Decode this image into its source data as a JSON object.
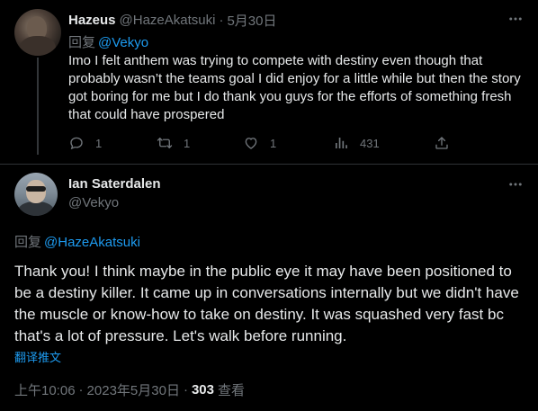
{
  "reply_tweet": {
    "author_name": "Hazeus",
    "author_handle": "@HazeAkatsuki",
    "separator": "·",
    "date": "5月30日",
    "reply_prefix": "回复",
    "reply_to": "@Vekyo",
    "text": "Imo I felt anthem was trying to compete with destiny even though that probably wasn’t the teams goal I did enjoy for a little while but then the story got boring for me but I do thank you guys for the efforts of something fresh that could have prospered",
    "actions": {
      "reply_count": "1",
      "retweet_count": "1",
      "like_count": "1",
      "view_count": "431"
    },
    "icons": [
      "more-icon",
      "reply-icon",
      "retweet-icon",
      "like-icon",
      "views-icon",
      "share-icon"
    ]
  },
  "main_tweet": {
    "author_name": "Ian Saterdalen",
    "author_handle": "@Vekyo",
    "reply_prefix": "回复",
    "reply_to": "@HazeAkatsuki",
    "text": "Thank you! I think maybe in the public eye it may have been positioned to be a destiny killer. It came up in conversations internally but we didn't have the muscle or know-how to take on destiny. It was squashed very fast bc that's a lot of pressure. Let's walk before running.",
    "translate_label": "翻译推文",
    "time": "上午10:06",
    "separator": "·",
    "date": "2023年5月30日",
    "views_count": "303",
    "views_label": "查看"
  },
  "colors": {
    "background": "#000000",
    "text_primary": "#e7e9ea",
    "text_secondary": "#71767b",
    "accent": "#1d9bf0",
    "divider": "#2f3336"
  }
}
